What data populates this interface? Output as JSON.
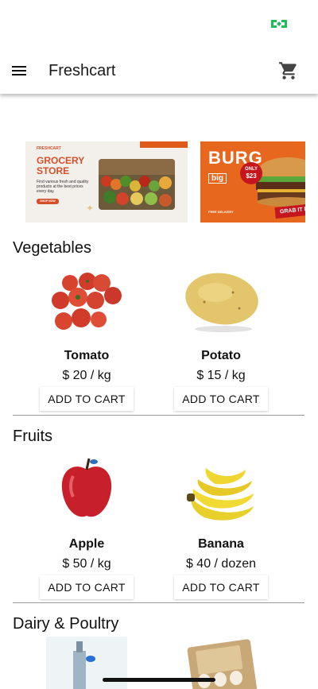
{
  "app": {
    "title": "Freshcart"
  },
  "icons": {
    "menu": "hamburger-menu-icon",
    "cart": "shopping-cart-icon",
    "status": "network-indicator-icon"
  },
  "colors": {
    "accent": "#1fbd5a",
    "banner_orange": "#e05a1a",
    "text": "#111111"
  },
  "banners": [
    {
      "name": "grocery",
      "brand": "FRESHCART",
      "title_line1": "GROCERY",
      "title_line2": "STORE",
      "subtitle": "Find various fresh and quality products at the best prices every day.",
      "button": "SHOP NOW"
    },
    {
      "name": "burger",
      "title": "BURG",
      "badge_line1": "ONLY",
      "badge_line2": "$23",
      "logo": "big",
      "delivery": "FREE DELIVERY",
      "cta": "GRAB IT N"
    }
  ],
  "sections": [
    {
      "title": "Vegetables",
      "items": [
        {
          "name": "Tomato",
          "price": "$ 20 / kg",
          "button": "ADD TO CART"
        },
        {
          "name": "Potato",
          "price": "$ 15 / kg",
          "button": "ADD TO CART"
        }
      ]
    },
    {
      "title": "Fruits",
      "items": [
        {
          "name": "Apple",
          "price": "$ 50 / kg",
          "button": "ADD TO CART"
        },
        {
          "name": "Banana",
          "price": "$ 40 / dozen",
          "button": "ADD TO CART"
        }
      ]
    },
    {
      "title": "Dairy & Poultry"
    }
  ]
}
